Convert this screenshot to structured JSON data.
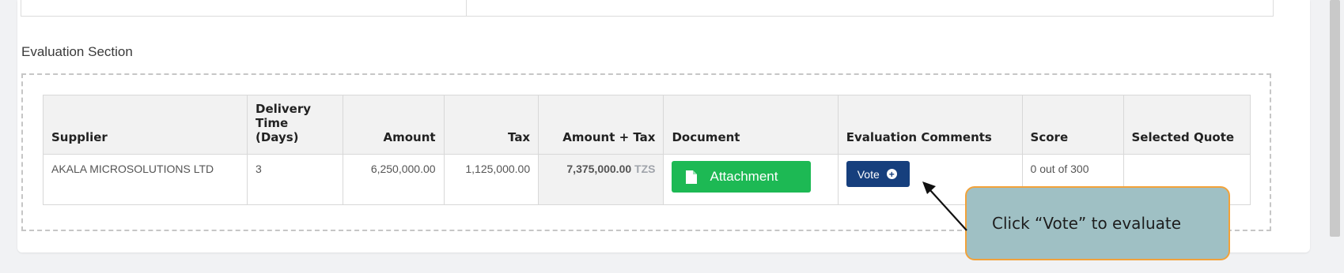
{
  "evaluation_section": {
    "title": "Evaluation Section",
    "columns": {
      "supplier": "Supplier",
      "delivery_time_line1": "Delivery",
      "delivery_time_line2": "Time (Days)",
      "amount": "Amount",
      "tax": "Tax",
      "amount_plus_tax": "Amount + Tax",
      "document": "Document",
      "evaluation_comments": "Evaluation Comments",
      "score": "Score",
      "selected_quote": "Selected Quote"
    },
    "rows": [
      {
        "supplier": "AKALA MICROSOLUTIONS LTD",
        "delivery_time": "3",
        "amount": "6,250,000.00",
        "tax": "1,125,000.00",
        "total": "7,375,000.00",
        "currency": "TZS",
        "document_button": "Attachment",
        "vote_button": "Vote",
        "score": "0 out of 300",
        "selected_quote": ""
      }
    ]
  },
  "callout": {
    "text": "Click “Vote” to evaluate"
  },
  "icons": {
    "document": "file-icon",
    "vote": "plus-circle-icon"
  },
  "colors": {
    "attachment_button": "#1db954",
    "vote_button": "#163f7d",
    "supplier_link": "#4f7fc0",
    "callout_fill": "#9fc0c4",
    "callout_border": "#f2a23a"
  }
}
